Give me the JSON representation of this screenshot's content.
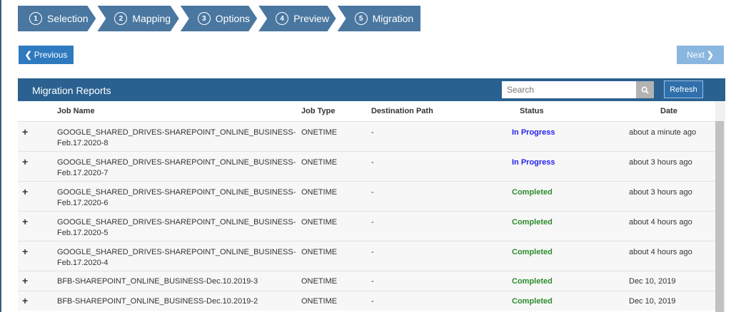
{
  "steps": [
    {
      "n": "1",
      "label": "Selection"
    },
    {
      "n": "2",
      "label": "Mapping"
    },
    {
      "n": "3",
      "label": "Options"
    },
    {
      "n": "4",
      "label": "Preview"
    },
    {
      "n": "5",
      "label": "Migration"
    }
  ],
  "nav": {
    "previous": "Previous",
    "next": "Next"
  },
  "panel": {
    "title": "Migration Reports",
    "search_placeholder": "Search",
    "refresh": "Refresh"
  },
  "columns": [
    "Job Name",
    "Job Type",
    "Destination Path",
    "Status",
    "Date"
  ],
  "colors": {
    "in_progress": "#2222ee",
    "completed": "#2e8b2e",
    "header": "#2a6190"
  },
  "rows": [
    {
      "name": "GOOGLE_SHARED_DRIVES-SHAREPOINT_ONLINE_BUSINESS-",
      "name2": "Feb.17.2020-8",
      "type": "ONETIME",
      "dest": "-",
      "status": "In Progress",
      "date": "about a minute ago"
    },
    {
      "name": "GOOGLE_SHARED_DRIVES-SHAREPOINT_ONLINE_BUSINESS-",
      "name2": "Feb.17.2020-7",
      "type": "ONETIME",
      "dest": "-",
      "status": "In Progress",
      "date": "about 3 hours ago"
    },
    {
      "name": "GOOGLE_SHARED_DRIVES-SHAREPOINT_ONLINE_BUSINESS-",
      "name2": "Feb.17.2020-6",
      "type": "ONETIME",
      "dest": "-",
      "status": "Completed",
      "date": "about 3 hours ago"
    },
    {
      "name": "GOOGLE_SHARED_DRIVES-SHAREPOINT_ONLINE_BUSINESS-",
      "name2": "Feb.17.2020-5",
      "type": "ONETIME",
      "dest": "-",
      "status": "Completed",
      "date": "about 4 hours ago"
    },
    {
      "name": "GOOGLE_SHARED_DRIVES-SHAREPOINT_ONLINE_BUSINESS-",
      "name2": "Feb.17.2020-4",
      "type": "ONETIME",
      "dest": "-",
      "status": "Completed",
      "date": "about 4 hours ago"
    },
    {
      "name": "BFB-SHAREPOINT_ONLINE_BUSINESS-Dec.10.2019-3",
      "name2": "",
      "type": "ONETIME",
      "dest": "-",
      "status": "Completed",
      "date": "Dec 10, 2019"
    },
    {
      "name": "BFB-SHAREPOINT_ONLINE_BUSINESS-Dec.10.2019-2",
      "name2": "",
      "type": "ONETIME",
      "dest": "-",
      "status": "Completed",
      "date": "Dec 10, 2019"
    }
  ]
}
